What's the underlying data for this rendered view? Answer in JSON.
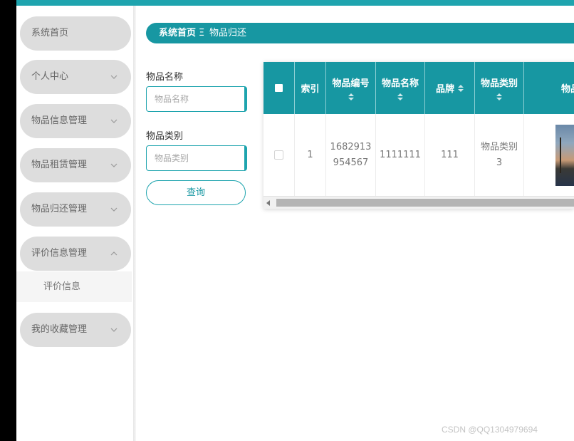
{
  "sidebar": {
    "items": [
      {
        "label": "系统首页",
        "has_chevron": false
      },
      {
        "label": "个人中心",
        "chevron": "down"
      },
      {
        "label": "物品信息管理",
        "chevron": "down"
      },
      {
        "label": "物品租赁管理",
        "chevron": "down"
      },
      {
        "label": "物品归还管理",
        "chevron": "down"
      },
      {
        "label": "评价信息管理",
        "chevron": "up",
        "expanded": true
      },
      {
        "label": "我的收藏管理",
        "chevron": "down"
      }
    ],
    "submenu": [
      {
        "label": "评价信息"
      }
    ]
  },
  "breadcrumb": {
    "home": "系统首页",
    "separator": "Ξ",
    "current": "物品归还"
  },
  "search": {
    "name_label": "物品名称",
    "name_placeholder": "物品名称",
    "category_label": "物品类别",
    "category_placeholder": "物品类别",
    "button_label": "查询"
  },
  "table": {
    "headers": {
      "index": "索引",
      "item_no": "物品编号",
      "item_name": "物品名称",
      "brand": "品牌",
      "category": "物品类别",
      "image": "物品"
    },
    "rows": [
      {
        "index": "1",
        "item_no_line1": "1682913",
        "item_no_line2": "954567",
        "item_name": "1111111",
        "brand": "111",
        "category_line1": "物品类别",
        "category_line2": "3"
      }
    ]
  },
  "watermark": "CSDN @QQ1304979694",
  "colors": {
    "primary": "#1797a2",
    "accent": "#1ea4ae",
    "menu_bg": "#dddddd"
  }
}
